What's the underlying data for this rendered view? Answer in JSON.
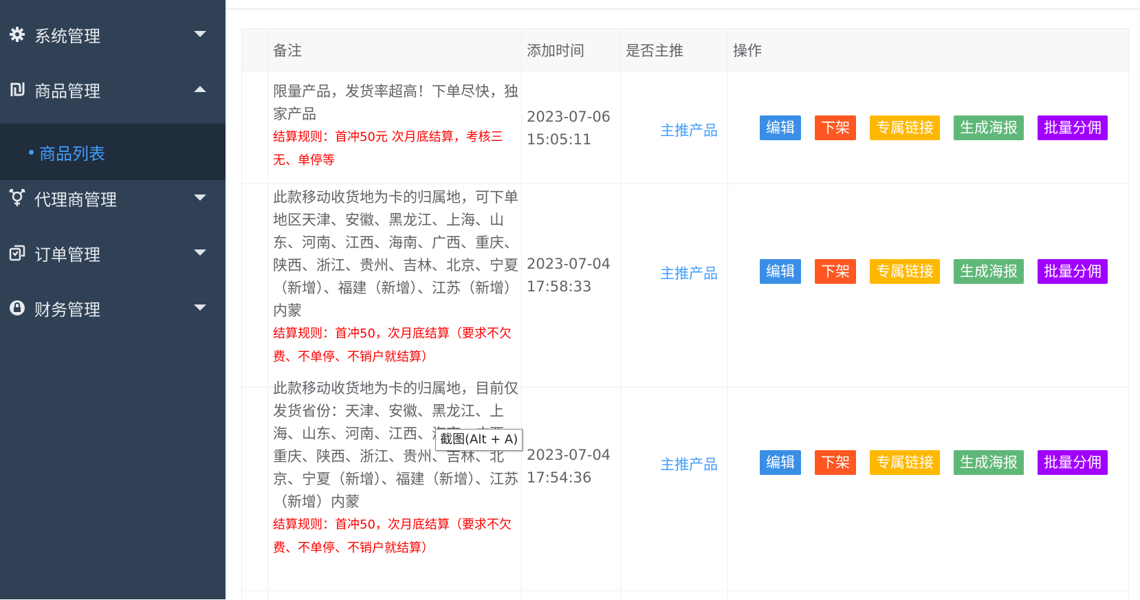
{
  "sidebar": {
    "items": [
      {
        "label": "系统管理",
        "icon": "gear-icon",
        "expanded": false
      },
      {
        "label": "商品管理",
        "icon": "shekel-icon",
        "expanded": true
      },
      {
        "label": "代理商管理",
        "icon": "gender-icon",
        "expanded": false
      },
      {
        "label": "订单管理",
        "icon": "clipboard-icon",
        "expanded": false
      },
      {
        "label": "财务管理",
        "icon": "lock-icon",
        "expanded": false
      }
    ],
    "submenu": {
      "label": "商品列表"
    }
  },
  "table": {
    "headers": {
      "remark": "备注",
      "time": "添加时间",
      "main": "是否主推",
      "actions": "操作"
    },
    "rows": [
      {
        "remark": "限量产品，发货率超高！下单尽快，独家产品",
        "rule": "结算规则：首冲50元 次月底结算，考核三无、单停等",
        "time": "2023-07-06 15:05:11",
        "main": "主推产品"
      },
      {
        "remark": "此款移动收货地为卡的归属地，可下单地区天津、安徽、黑龙江、上海、山东、河南、江西、海南、广西、重庆、陕西、浙江、贵州、吉林、北京、宁夏（新增）、福建（新增）、江苏（新增）内蒙",
        "rule": "结算规则：首冲50，次月底结算（要求不欠费、不单停、不销户就结算）",
        "time": "2023-07-04 17:58:33",
        "main": "主推产品"
      },
      {
        "remark": "此款移动收货地为卡的归属地，目前仅发货省份：天津、安徽、黑龙江、上海、山东、河南、江西、海南、广西、重庆、陕西、浙江、贵州、吉林、北京、宁夏（新增）、福建（新增）、江苏（新增）内蒙",
        "rule": "结算规则：首冲50，次月底结算（要求不欠费、不单停、不销户就结算）",
        "time": "2023-07-04 17:54:36",
        "main": "主推产品"
      }
    ],
    "actions": {
      "edit": "编辑",
      "offshelf": "下架",
      "link": "专属链接",
      "poster": "生成海报",
      "batch": "批量分佣"
    }
  },
  "tooltip": "截图(Alt + A)",
  "colors": {
    "sidebar_bg": "#304156",
    "sidebar_active_bg": "#1f2d3d",
    "accent": "#409eff",
    "rule_red": "#ff0000",
    "btn_edit": "#3a8ee6",
    "btn_offshelf": "#ff5722",
    "btn_link": "#ffb800",
    "btn_poster": "#5fb878",
    "btn_batch": "#a100ff"
  }
}
